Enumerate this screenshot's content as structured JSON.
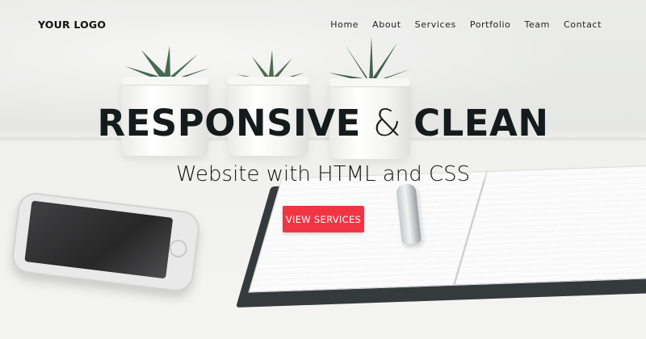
{
  "header": {
    "logo": "YOUR LOGO",
    "nav": [
      "Home",
      "About",
      "Services",
      "Portfolio",
      "Team",
      "Contact"
    ]
  },
  "hero": {
    "title_part1": "RESPONSIVE",
    "title_amp": "&",
    "title_part2": "CLEAN",
    "subtitle": "Website with HTML and CSS",
    "cta_label": "VIEW SERVICES"
  },
  "colors": {
    "accent": "#f13444",
    "text_dark": "#151a1c"
  }
}
